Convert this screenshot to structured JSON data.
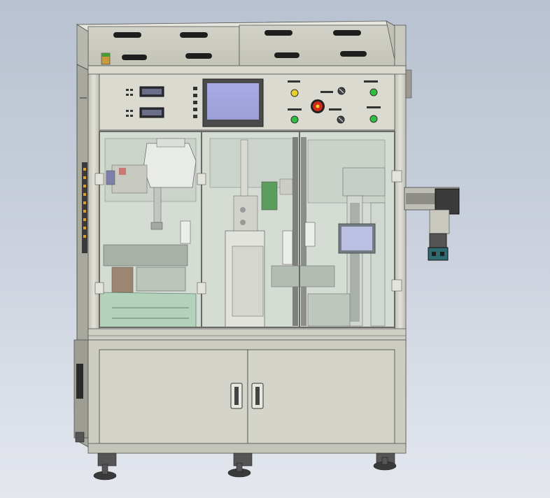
{
  "panel_labels": {
    "top_vertical": "",
    "right_top_left": "",
    "right_top_mid": "",
    "right_top_right": "",
    "right_bottom_left": "",
    "right_bottom_right": ""
  },
  "hmi_screen_color": "#a4a6e0",
  "frame_color": "#d6d6cc",
  "glass_tint": "#cfd9cf",
  "lamp_colors": {
    "green": "#2fbf3f",
    "yellow": "#e8d22a",
    "red": "#d12a1a",
    "dark": "#333333"
  },
  "icons": [
    "estop-button-icon",
    "indicator-lamp-icon",
    "selector-switch-icon",
    "vent-slot-icon",
    "door-handle-icon",
    "leveling-foot-icon",
    "motor-icon",
    "gripper-icon",
    "hmi-screen-icon",
    "counter-display-icon"
  ]
}
